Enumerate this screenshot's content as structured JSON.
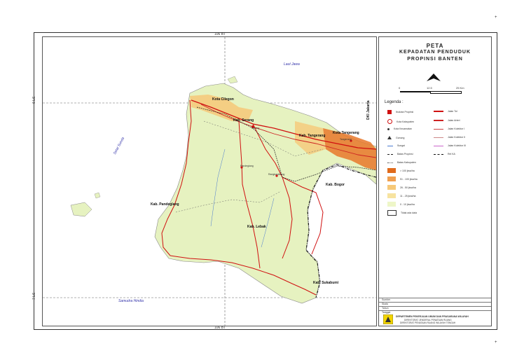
{
  "corner_marks": [
    "+",
    "+"
  ],
  "grid": {
    "top_lon": "106 BT",
    "bottom_lon": "106 BT",
    "left_lat_top": "6 LS",
    "left_lat_bottom": "7 LS"
  },
  "title": {
    "line1": "PETA",
    "line2": "KEPADATAN PENDUDUK",
    "line3": "PROPINSI BANTEN"
  },
  "scale": {
    "labels": [
      "0",
      "12.5",
      "25 Km"
    ]
  },
  "legend": {
    "heading": "Legenda :",
    "left_items": [
      "Ibukota Propinsi",
      "Kota Kabupaten",
      "Kota Kecamatan",
      "Gunung",
      "Sungai",
      "Batas Propinsi",
      "Batas Kabupaten"
    ],
    "right_items": [
      "Jalan Tol",
      "Jalan Arteri",
      "Jalan Kolektor I",
      "Jalan Kolektor II",
      "Jalan Kolektor III",
      "Rel KA"
    ],
    "density_classes": [
      "> 100 jiwa/ha",
      "51 - 100 jiwa/ha",
      "26 - 50 jiwa/ha",
      "11 - 25 jiwa/ha",
      "0 - 10 jiwa/ha",
      "Tidak ada data"
    ],
    "density_colors": [
      "#e06a1c",
      "#f0a050",
      "#f6c878",
      "#f7e3a0",
      "#eef6c8",
      "#ffffff"
    ]
  },
  "footer": {
    "rows": [
      "Sumber",
      "Skala",
      "Tahun",
      "Tanggal"
    ],
    "org_line1": "DEPARTEMEN PEKERJAAN UMUM DAN PRASARANA WILAYAH",
    "org_line2": "DIREKTORAT JENDERAL PENATAAN RUANG",
    "org_line3": "DIREKTORAT PENATAAN RUANG WILAYAH TENGAH"
  },
  "map_labels": {
    "laut_jawa": "Laut Jawa",
    "selat_sunda": "Selat Sunda",
    "samudra": "Samudra Hindia",
    "dki": "DKI Jakarta",
    "kota_cilegon": "Kota Cilegon",
    "kab_serang": "Kab. Serang",
    "serang": "Serang",
    "kab_tangerang": "Kab. Tangerang",
    "kota_tangerang": "Kota Tangerang",
    "tangerang": "Tangerang",
    "pandeglang": "Pandeglang",
    "rangkasbitung": "Rangkasbitung",
    "kab_bogor": "Kab. Bogor",
    "kab_pandeglang": "Kab. Pandeglang",
    "kab_lebak": "Kab. Lebak",
    "kab_sukabumi": "Kab. Sukabumi"
  },
  "colors": {
    "land_light": "#e6f2c0",
    "ocean": "#ffffff",
    "road_primary": "#d01010",
    "road_secondary": "#cc8888",
    "boundary": "#222222",
    "urban": "#e8782a"
  }
}
